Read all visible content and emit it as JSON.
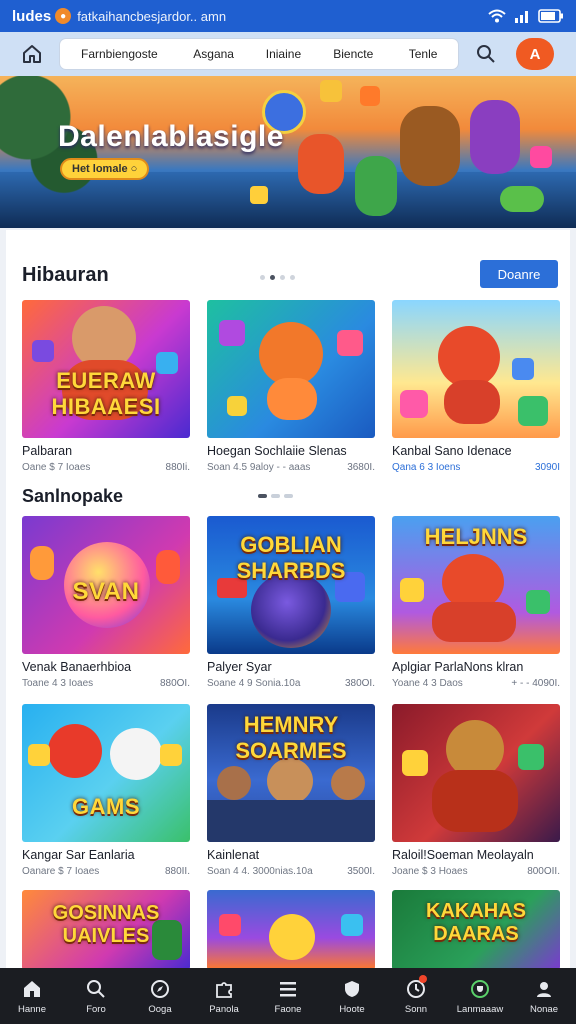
{
  "status_bar": {
    "brand": "ludes",
    "url": "fatkaihancbesjardor.. amn",
    "icons": [
      "wifi-icon",
      "signal-icon",
      "battery-icon"
    ]
  },
  "navbar": {
    "tabs": [
      "Farnbiengoste",
      "Asgana",
      "Iniaine",
      "Biencte",
      "Tenle"
    ],
    "menu_label": "A",
    "accent": "#f05a22"
  },
  "hero": {
    "title": "Dalenlablasigle",
    "cta": "Het lomale ○"
  },
  "section1": {
    "title": "Hibauran",
    "see_all": "Doanre",
    "cards": [
      {
        "thumb_text": "EUERAW HIBAAESI",
        "name": "Palbaran",
        "meta_left": "Oane  $ 7 Ioaes",
        "meta_right": "880Ii.",
        "meta_style": "grey"
      },
      {
        "thumb_text": "",
        "name": "Hoegan Sochlaiie Slenas",
        "meta_left": "Soan  4.5  9aloy - - aaas",
        "meta_right": "3680I.",
        "meta_style": "grey"
      },
      {
        "thumb_text": "",
        "name": "Kanbal Sano Idenace",
        "meta_left": "Qana  6 3  Ioens",
        "meta_right": "3090I",
        "meta_style": "blue"
      }
    ]
  },
  "section2": {
    "title": "Sanlnopake",
    "cards": [
      {
        "thumb_text": "SVAN",
        "name": "Venak Banaerhbioa",
        "meta_left": "Toane  4 3  Ioaes",
        "meta_right": "880OI.",
        "meta_style": "grey"
      },
      {
        "thumb_text": "GOBLIAN SHARBDS",
        "name": "Palyer Syar",
        "meta_left": "Soane  4 9 Sonia.10a",
        "meta_right": "380OI.",
        "meta_style": "grey"
      },
      {
        "thumb_text": "HELJNNS",
        "name": "Aplgiar ParlaNons klran",
        "meta_left": "Yoane  4 3  Daos",
        "meta_right": "+ - - 4090I.",
        "meta_style": "grey"
      }
    ]
  },
  "section3": {
    "cards": [
      {
        "thumb_text": "GAMS",
        "name": "Kangar Sar Eanlaria",
        "meta_left": "Oanare  $ 7  Ioaes",
        "meta_right": "880II.",
        "meta_style": "grey"
      },
      {
        "thumb_text": "HEMNRY SOARMES",
        "name": "Kainlenat",
        "meta_left": "Soan  4  4. 3000nias.10a",
        "meta_right": "3500I.",
        "meta_style": "grey"
      },
      {
        "thumb_text": "",
        "name": "Raloil!Soeman Meolayaln",
        "meta_left": "Joane  $ 3  Hoaes",
        "meta_right": "800OII.",
        "meta_style": "grey"
      }
    ]
  },
  "section4": {
    "cards": [
      {
        "thumb_text": "GOSINNAS UAIVLES"
      },
      {
        "thumb_text": ""
      },
      {
        "thumb_text": "KAKAHAS DAARAS"
      }
    ]
  },
  "bottom_nav": [
    {
      "label": "Hanne",
      "icon": "home-icon"
    },
    {
      "label": "Foro",
      "icon": "search-icon"
    },
    {
      "label": "Ooga",
      "icon": "compass-icon"
    },
    {
      "label": "Panola",
      "icon": "puzzle-icon"
    },
    {
      "label": "Faone",
      "icon": "list-icon"
    },
    {
      "label": "Hoote",
      "icon": "shield-icon"
    },
    {
      "label": "Sonn",
      "icon": "clock-icon"
    },
    {
      "label": "Lanmaaaw",
      "icon": "trophy-icon"
    },
    {
      "label": "Nonae",
      "icon": "user-icon"
    }
  ]
}
